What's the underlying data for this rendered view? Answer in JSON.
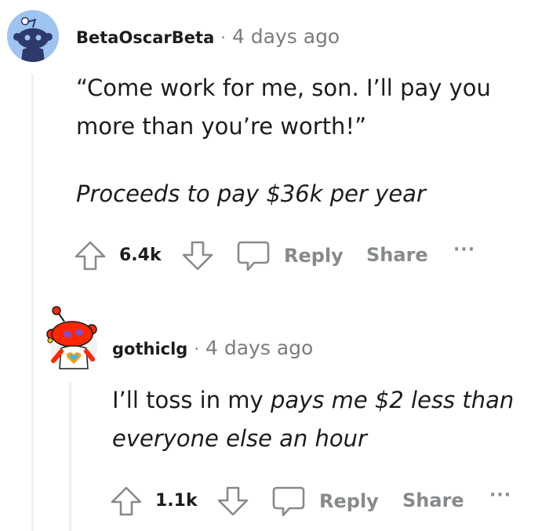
{
  "comment1": {
    "username": "BetaOscarBeta",
    "separator": "·",
    "time": "4 days ago",
    "line1": "“Come work for me, son. I’ll pay you",
    "line2": "more than you’re worth!”",
    "line3": "Proceeds to pay $36k per year",
    "votes": "6.4k",
    "reply_label": "Reply",
    "share_label": "Share",
    "more_label": "···"
  },
  "comment2": {
    "username": "gothiclg",
    "separator": "·",
    "time": "4 days ago",
    "line1_prefix": "I’ll toss in my ",
    "line1_italic": "pays me $2 less than",
    "line2": "everyone else an hour",
    "votes": "1.1k",
    "reply_label": "Reply",
    "share_label": "Share",
    "more_label": "···"
  },
  "icons": {
    "upvote": "arrow-up-outline",
    "downvote": "arrow-down-outline",
    "comment": "speech-bubble-outline",
    "avatar1": "snoo-avatar-blue",
    "avatar2": "snoo-avatar-red-custom"
  },
  "colors": {
    "text": "#1c1c1c",
    "muted": "#878a8c",
    "thread_line": "#edeff1",
    "avatar1_bg": "#9fc4f2",
    "avatar2_red": "#ff2600"
  }
}
